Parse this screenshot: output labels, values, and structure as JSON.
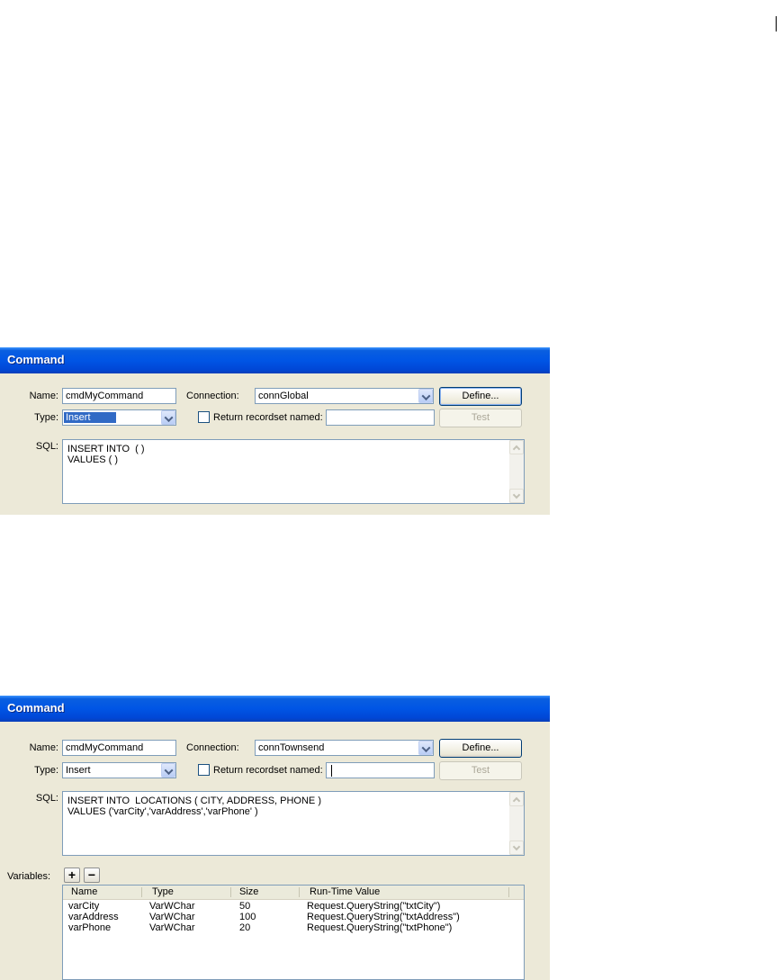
{
  "dialog1": {
    "title": "Command",
    "name_label": "Name:",
    "name_value": "cmdMyCommand",
    "connection_label": "Connection:",
    "connection_value": "connGlobal",
    "define_label": "Define...",
    "type_label": "Type:",
    "type_value": "Insert",
    "return_label": "Return recordset named:",
    "return_value": "",
    "test_label": "Test",
    "sql_label": "SQL:",
    "sql_lines": [
      "INSERT INTO  ( )",
      "VALUES ( )"
    ]
  },
  "dialog2": {
    "title": "Command",
    "name_label": "Name:",
    "name_value": "cmdMyCommand",
    "connection_label": "Connection:",
    "connection_value": "connTownsend",
    "define_label": "Define...",
    "type_label": "Type:",
    "type_value": "Insert",
    "return_label": "Return recordset named:",
    "return_value": "",
    "test_label": "Test",
    "sql_label": "SQL:",
    "sql_lines": [
      "INSERT INTO  LOCATIONS ( CITY, ADDRESS, PHONE )",
      "VALUES ('varCity','varAddress','varPhone' )"
    ],
    "variables_label": "Variables:",
    "add_label": "+",
    "remove_label": "−",
    "columns": [
      "Name",
      "Type",
      "Size",
      "Run-Time Value"
    ],
    "rows": [
      [
        "varCity",
        "VarWChar",
        "50",
        "Request.QueryString(\"txtCity\")"
      ],
      [
        "varAddress",
        "VarWChar",
        "100",
        "Request.QueryString(\"txtAddress\")"
      ],
      [
        "varPhone",
        "VarWChar",
        "20",
        "Request.QueryString(\"txtPhone\")"
      ]
    ]
  }
}
